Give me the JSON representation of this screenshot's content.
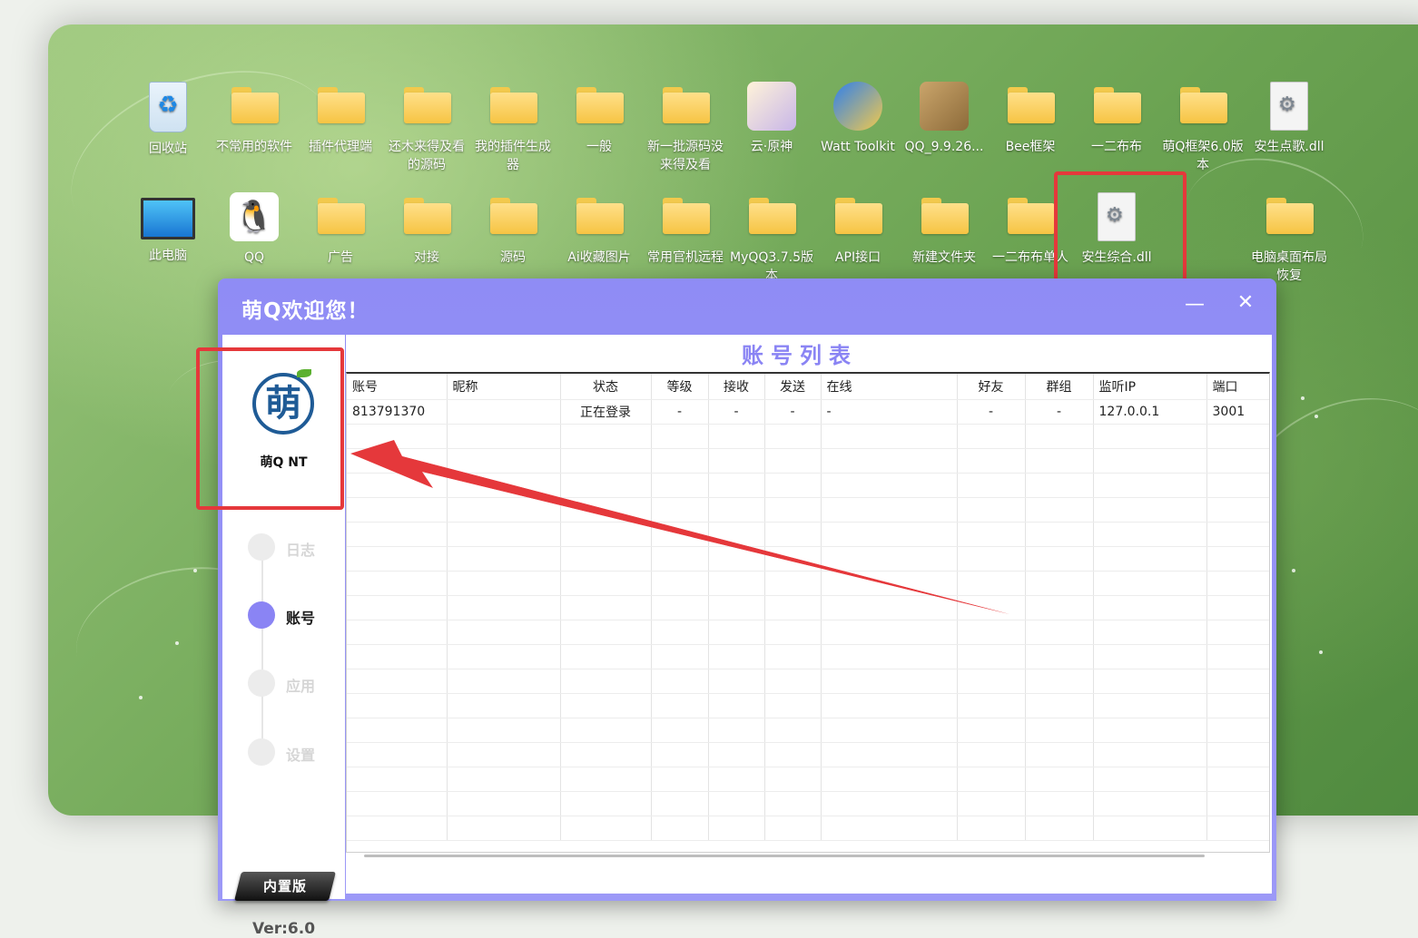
{
  "desktop": {
    "row1": [
      {
        "label": "回收站",
        "icon": "recycle-bin-icon"
      },
      {
        "label": "不常用的软件",
        "icon": "folder-icon"
      },
      {
        "label": "插件代理端",
        "icon": "folder-icon"
      },
      {
        "label": "还木来得及看的源码",
        "icon": "folder-icon"
      },
      {
        "label": "我的插件生成器",
        "icon": "folder-icon"
      },
      {
        "label": "一般",
        "icon": "folder-icon"
      },
      {
        "label": "新一批源码没来得及看",
        "icon": "folder-icon"
      },
      {
        "label": "云·原神",
        "icon": "genshin-app-icon"
      },
      {
        "label": "Watt Toolkit",
        "icon": "watt-toolkit-icon"
      },
      {
        "label": "QQ_9.9.26...",
        "icon": "qq-installer-icon"
      },
      {
        "label": "Bee框架",
        "icon": "folder-icon"
      },
      {
        "label": "一二布布",
        "icon": "folder-icon"
      },
      {
        "label": "萌Q框架6.0版本",
        "icon": "folder-icon"
      },
      {
        "label": "安生点歌.dll",
        "icon": "dll-file-icon"
      }
    ],
    "row2": [
      {
        "label": "此电脑",
        "icon": "computer-icon"
      },
      {
        "label": "QQ",
        "icon": "qq-icon"
      },
      {
        "label": "广告",
        "icon": "folder-icon"
      },
      {
        "label": "对接",
        "icon": "folder-icon"
      },
      {
        "label": "源码",
        "icon": "folder-icon"
      },
      {
        "label": "Ai收藏图片",
        "icon": "folder-icon"
      },
      {
        "label": "常用官机远程",
        "icon": "folder-icon"
      },
      {
        "label": "MyQQ3.7.5版本",
        "icon": "folder-icon"
      },
      {
        "label": "API接口",
        "icon": "folder-icon"
      },
      {
        "label": "新建文件夹",
        "icon": "folder-icon"
      },
      {
        "label": "一二布布单人",
        "icon": "folder-icon"
      },
      {
        "label": "安生综合.dll",
        "icon": "dll-file-icon"
      },
      {
        "label": "电脑桌面布局恢复",
        "icon": "folder-icon"
      }
    ]
  },
  "window": {
    "title": "萌Q欢迎您！",
    "minimize_glyph": "—",
    "close_glyph": "✕"
  },
  "sidebar": {
    "logo_char": "萌",
    "logo_text": "萌Q NT",
    "nav": [
      {
        "label": "日志",
        "active": false
      },
      {
        "label": "账号",
        "active": true
      },
      {
        "label": "应用",
        "active": false
      },
      {
        "label": "设置",
        "active": false
      }
    ],
    "badge": "内置版",
    "version": "Ver:6.0"
  },
  "main": {
    "title": "账号列表",
    "columns": [
      "账号",
      "昵称",
      "状态",
      "等级",
      "接收",
      "发送",
      "在线",
      "好友",
      "群组",
      "监听IP",
      "端口"
    ],
    "rows": [
      [
        "813791370",
        "",
        "正在登录",
        "-",
        "-",
        "-",
        "-",
        "-",
        "-",
        "127.0.0.1",
        "3001"
      ]
    ]
  },
  "colors": {
    "accent": "#8a84f4",
    "highlight": "#e5383b",
    "logo": "#1f5b96"
  }
}
